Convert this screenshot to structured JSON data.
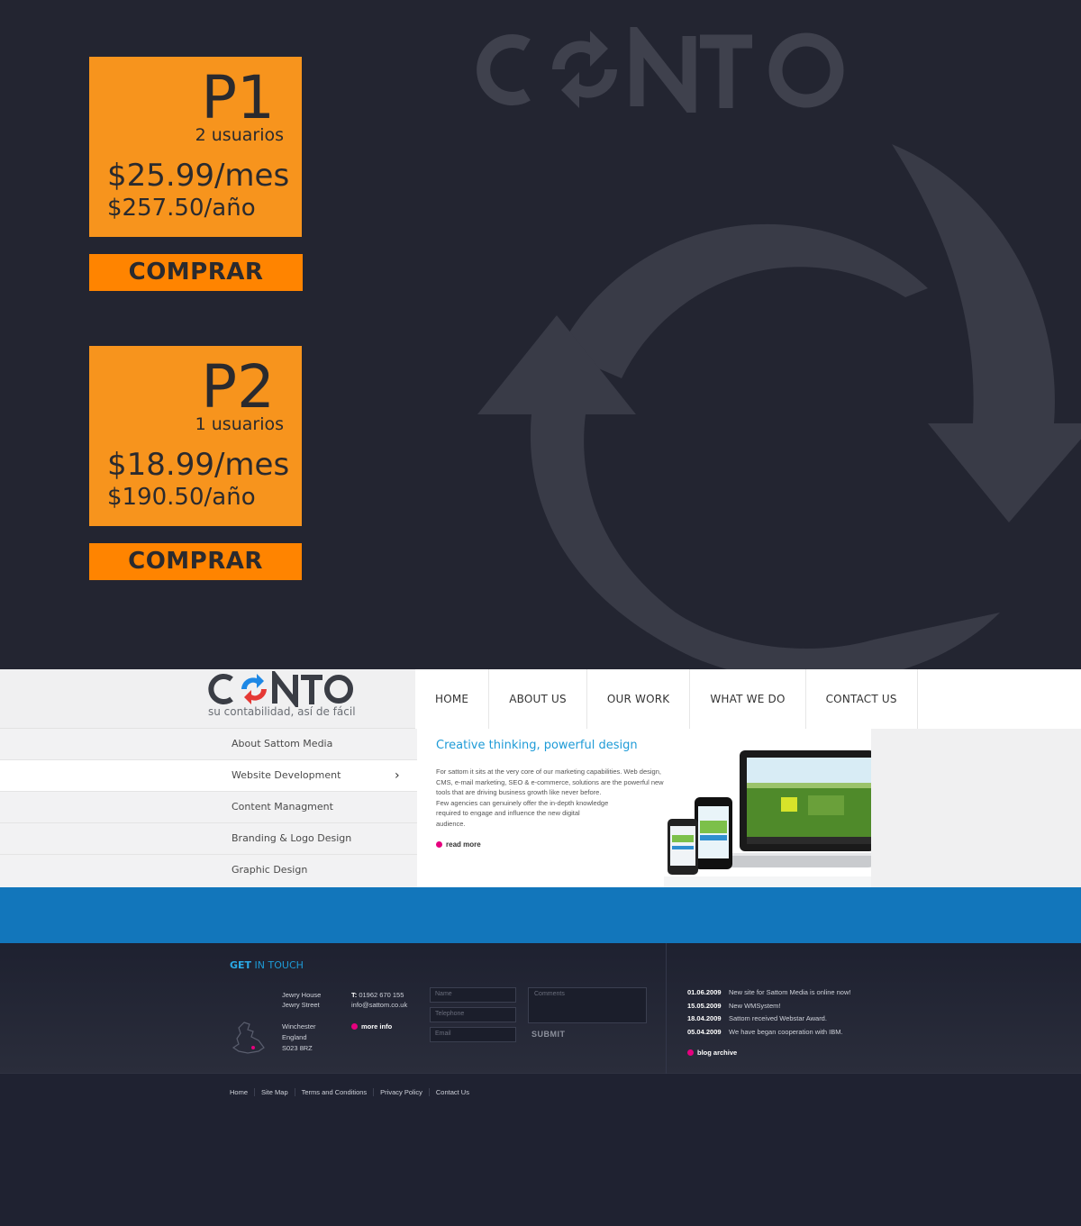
{
  "brand": {
    "name": "CONTO",
    "tagline": "su contabilidad, así de fácil"
  },
  "plans": [
    {
      "name": "P1",
      "users": "2 usuarios",
      "price_month": "$25.99/mes",
      "price_year": "$257.50/año",
      "buy_label": "COMPRAR"
    },
    {
      "name": "P2",
      "users": "1 usuarios",
      "price_month": "$18.99/mes",
      "price_year": "$190.50/año",
      "buy_label": "COMPRAR"
    }
  ],
  "nav": [
    "HOME",
    "ABOUT US",
    "OUR WORK",
    "WHAT WE DO",
    "CONTACT US"
  ],
  "sidebar": {
    "items": [
      "About Sattom Media",
      "Website Development",
      "Content Managment",
      "Branding & Logo Design",
      "Graphic Design"
    ],
    "active_index": 1
  },
  "content": {
    "title": "Creative thinking, powerful design",
    "body_lines": [
      "For sattom it sits at the very core of our marketing capabilities. Web design,",
      "CMS, e-mail marketing, SEO & e-commerce, solutions are the powerful new",
      "tools that are driving business growth like never before.",
      "Few agencies can genuinely offer the in-depth knowledge",
      "required to engage and influence the new digital",
      "audience."
    ],
    "read_more": "read more"
  },
  "footer": {
    "heading_bold": "GET",
    "heading_rest": " IN TOUCH",
    "address_top": [
      "Jewry House",
      "Jewry Street"
    ],
    "address_bottom": [
      "Winchester",
      "England",
      "S023 8RZ"
    ],
    "phone_label": "T:",
    "phone": "01962 670 155",
    "email": "info@sattom.co.uk",
    "more_info": "more info",
    "form": {
      "name_placeholder": "Name",
      "telephone_placeholder": "Telephone",
      "email_placeholder": "Email",
      "comments_placeholder": "Comments",
      "submit_label": "SUBMIT"
    },
    "news": [
      {
        "date": "01.06.2009",
        "text": "New site for Sattom Media is online now!"
      },
      {
        "date": "15.05.2009",
        "text": "New WMSystem!"
      },
      {
        "date": "18.04.2009",
        "text": "Sattom received Webstar Award."
      },
      {
        "date": "05.04.2009",
        "text": "We have began cooperation with IBM."
      }
    ],
    "blog_archive": "blog archive",
    "bottom_links": [
      "Home",
      "Site Map",
      "Terms and Conditions",
      "Privacy Policy",
      "Contact Us"
    ]
  },
  "colors": {
    "orange": "#f7941d",
    "buy_orange": "#ff8400",
    "accent_blue": "#1e9bd7",
    "band_blue": "#1276bb",
    "dark_bg": "#232531",
    "logo_blue": "#1e88e5",
    "logo_red": "#e53935"
  },
  "icons": [
    "refresh-arrows-icon",
    "chevron-right-icon",
    "bullet-icon",
    "uk-map-icon"
  ]
}
